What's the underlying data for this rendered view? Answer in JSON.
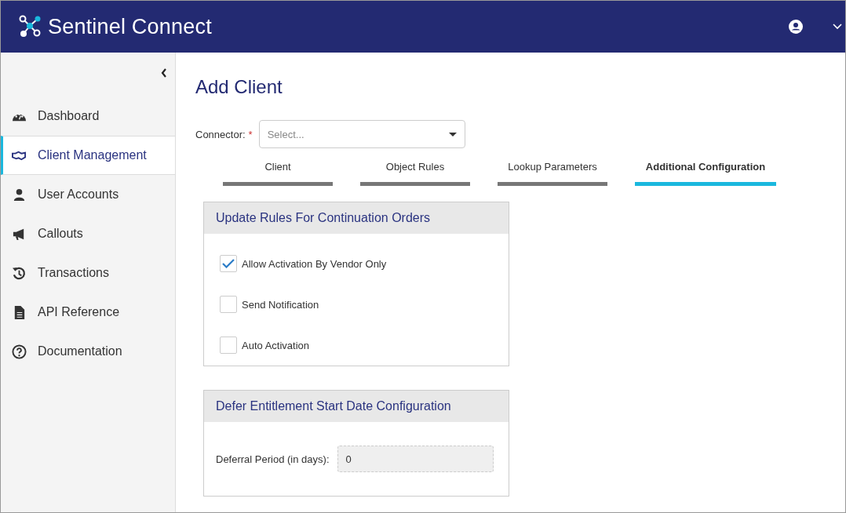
{
  "header": {
    "brand": "Sentinel Connect"
  },
  "sidebar": {
    "items": [
      {
        "label": "Dashboard",
        "selected": false
      },
      {
        "label": "Client Management",
        "selected": true
      },
      {
        "label": "User Accounts",
        "selected": false
      },
      {
        "label": "Callouts",
        "selected": false
      },
      {
        "label": "Transactions",
        "selected": false
      },
      {
        "label": "API Reference",
        "selected": false
      },
      {
        "label": "Documentation",
        "selected": false
      }
    ]
  },
  "page": {
    "title": "Add Client"
  },
  "connector": {
    "label": "Connector:",
    "required_mark": "*",
    "placeholder": "Select..."
  },
  "tabs": [
    {
      "label": "Client",
      "selected": false
    },
    {
      "label": "Object Rules",
      "selected": false
    },
    {
      "label": "Lookup Parameters",
      "selected": false
    },
    {
      "label": "Additional Configuration",
      "selected": true
    }
  ],
  "panels": [
    {
      "kind": "checkboxes",
      "title": "Update Rules For Continuation Orders",
      "options": [
        {
          "label": "Allow Activation By Vendor Only",
          "checked": true
        },
        {
          "label": "Send Notification",
          "checked": false
        },
        {
          "label": "Auto Activation",
          "checked": false
        }
      ]
    },
    {
      "kind": "field",
      "title": "Defer Entitlement Start Date Configuration",
      "field": {
        "label": "Deferral Period (in days):",
        "value": "0",
        "disabled": true
      }
    }
  ]
}
